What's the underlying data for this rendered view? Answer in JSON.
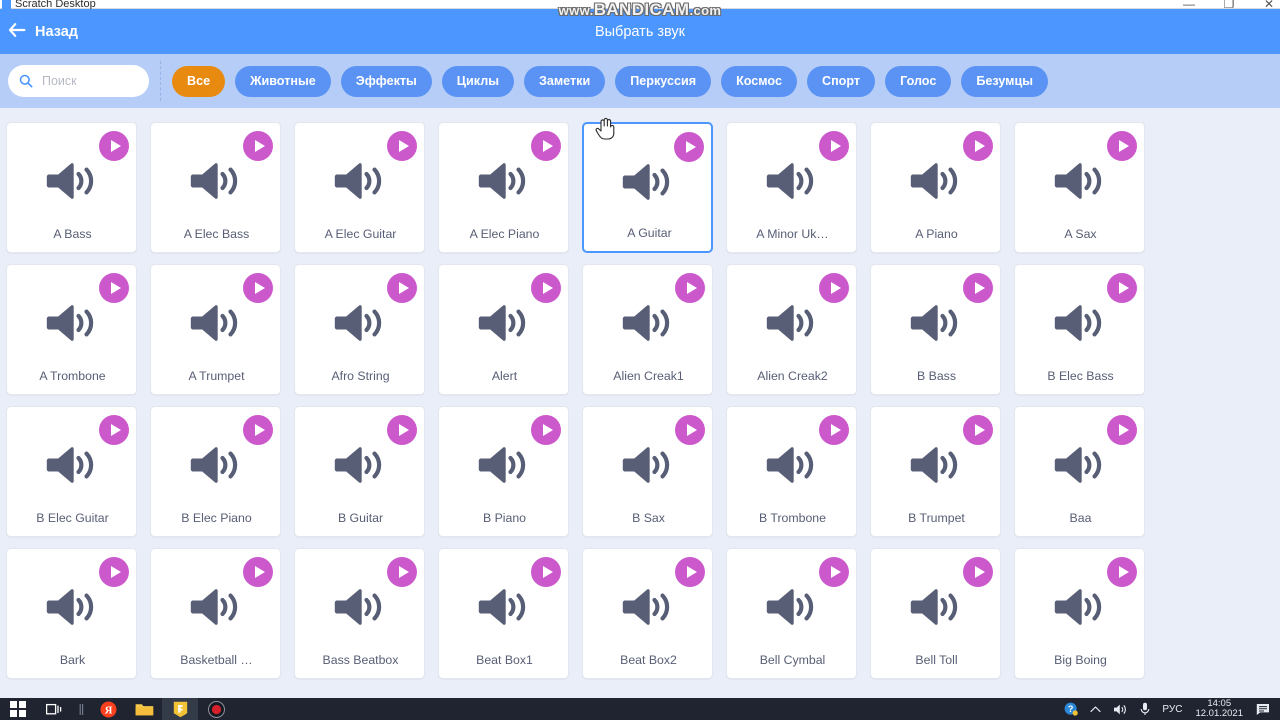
{
  "window": {
    "app_title": "Scratch Desktop",
    "controls": {
      "minimize": "—",
      "maximize": "❐",
      "close": "✕"
    }
  },
  "watermark": {
    "prefix": "www.",
    "main": "BANDICAM",
    "suffix": ".com"
  },
  "modal": {
    "back_label": "Назад",
    "back_icon": "arrow-left-icon",
    "title": "Выбрать звук"
  },
  "search": {
    "placeholder": "Поиск",
    "value": "",
    "icon": "search-icon"
  },
  "categories": [
    {
      "label": "Все",
      "active": true
    },
    {
      "label": "Животные",
      "active": false
    },
    {
      "label": "Эффекты",
      "active": false
    },
    {
      "label": "Циклы",
      "active": false
    },
    {
      "label": "Заметки",
      "active": false
    },
    {
      "label": "Перкуссия",
      "active": false
    },
    {
      "label": "Космос",
      "active": false
    },
    {
      "label": "Спорт",
      "active": false
    },
    {
      "label": "Голос",
      "active": false
    },
    {
      "label": "Безумцы",
      "active": false
    }
  ],
  "sounds": [
    {
      "label": "A Bass",
      "selected": false
    },
    {
      "label": "A Elec Bass",
      "selected": false
    },
    {
      "label": "A Elec Guitar",
      "selected": false
    },
    {
      "label": "A Elec Piano",
      "selected": false
    },
    {
      "label": "A Guitar",
      "selected": true
    },
    {
      "label": "A Minor Uk…",
      "selected": false
    },
    {
      "label": "A Piano",
      "selected": false
    },
    {
      "label": "A Sax",
      "selected": false
    },
    {
      "label": "A Trombone",
      "selected": false
    },
    {
      "label": "A Trumpet",
      "selected": false
    },
    {
      "label": "Afro String",
      "selected": false
    },
    {
      "label": "Alert",
      "selected": false
    },
    {
      "label": "Alien Creak1",
      "selected": false
    },
    {
      "label": "Alien Creak2",
      "selected": false
    },
    {
      "label": "B Bass",
      "selected": false
    },
    {
      "label": "B Elec Bass",
      "selected": false
    },
    {
      "label": "B Elec Guitar",
      "selected": false
    },
    {
      "label": "B Elec Piano",
      "selected": false
    },
    {
      "label": "B Guitar",
      "selected": false
    },
    {
      "label": "B Piano",
      "selected": false
    },
    {
      "label": "B Sax",
      "selected": false
    },
    {
      "label": "B Trombone",
      "selected": false
    },
    {
      "label": "B Trumpet",
      "selected": false
    },
    {
      "label": "Baa",
      "selected": false
    },
    {
      "label": "Bark",
      "selected": false
    },
    {
      "label": "Basketball …",
      "selected": false
    },
    {
      "label": "Bass Beatbox",
      "selected": false
    },
    {
      "label": "Beat Box1",
      "selected": false
    },
    {
      "label": "Beat Box2",
      "selected": false
    },
    {
      "label": "Bell Cymbal",
      "selected": false
    },
    {
      "label": "Bell Toll",
      "selected": false
    },
    {
      "label": "Big Boing",
      "selected": false
    }
  ],
  "taskbar": {
    "items": [
      {
        "name": "start-button",
        "icon": "windows-logo-icon"
      },
      {
        "name": "task-view-button",
        "icon": "task-view-icon"
      },
      {
        "name": "taskbar-separator",
        "icon": "separator-icon"
      },
      {
        "name": "yandex-browser-button",
        "icon": "yandex-icon"
      },
      {
        "name": "file-explorer-button",
        "icon": "folder-icon"
      },
      {
        "name": "scratch-desktop-button",
        "icon": "scratch-icon"
      },
      {
        "name": "bandicam-record-button",
        "icon": "record-icon"
      }
    ],
    "tray": {
      "help_icon": "help-icon",
      "chevron_icon": "chevron-up-icon",
      "volume_icon": "volume-icon",
      "microphone_icon": "microphone-icon",
      "language": "РУС",
      "time": "14:05",
      "date": "12.01.2021",
      "notifications_icon": "notification-icon"
    }
  },
  "colors": {
    "scratch_blue": "#4c97ff",
    "filter_bar": "#b5cdf7",
    "chip_blue": "#5b93f5",
    "chip_active_orange": "#e98a10",
    "play_magenta": "#cc59cc",
    "speaker_gray": "#575e75",
    "grid_bg": "#e9eef8",
    "taskbar": "#1f2430"
  }
}
